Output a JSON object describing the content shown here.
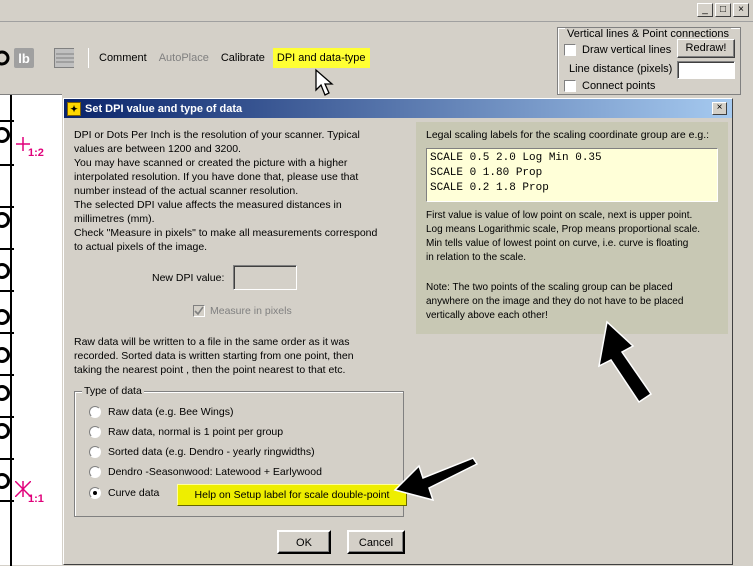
{
  "window": {
    "ctrls": [
      "_",
      "□",
      "×"
    ]
  },
  "toolbar": {
    "icons": [
      "circle-icon",
      "lb-icon",
      "grid-icon"
    ],
    "lb_text": "lb",
    "items": [
      {
        "label": "Comment",
        "state": "normal"
      },
      {
        "label": "AutoPlace",
        "state": "disabled"
      },
      {
        "label": "Calibrate",
        "state": "normal"
      },
      {
        "label": "DPI and data-type",
        "state": "highlight"
      }
    ]
  },
  "vertical_lines": {
    "title": "Vertical lines & Point connections",
    "draw_label": "Draw vertical lines",
    "redraw_label": "Redraw!",
    "distance_label": "Line distance (pixels)",
    "distance_value": "",
    "connect_label": "Connect points"
  },
  "canvas": {
    "label_top": "1:2",
    "label_bottom": "1:1"
  },
  "dialog": {
    "title": "Set DPI value and type of data",
    "close": "×",
    "intro": [
      "DPI or Dots Per Inch is the resolution of your scanner. Typical",
      "values are between 1200 and 3200.",
      "You may have scanned or created the picture with a higher",
      "interpolated resolution. If you have done that, please use that",
      "number instead of the actual scanner resolution.",
      "The selected DPI value affects the measured distances in",
      "millimetres (mm).",
      "Check \"Measure in pixels\" to make all measurements correspond",
      "to actual pixels of the image."
    ],
    "dpi_label": "New DPI value:",
    "dpi_value": "",
    "measure_label": "Measure in pixels",
    "raw_text": [
      "Raw data will be written to a file in the same order as it was",
      "recorded. Sorted data is written starting from one point, then",
      "taking the nearest point , then the point nearest to that etc."
    ],
    "type_group": "Type of data",
    "options": [
      {
        "label": "Raw data (e.g. Bee Wings)",
        "selected": false
      },
      {
        "label": "Raw data, normal is 1 point per group",
        "selected": false
      },
      {
        "label": "Sorted data (e.g. Dendro - yearly ringwidths)",
        "selected": false
      },
      {
        "label": "Dendro -Seasonwood: Latewood + Earlywood",
        "selected": false
      },
      {
        "label": "Curve data",
        "selected": true
      }
    ],
    "help_button": "Help on Setup label for scale double-point",
    "legal_title": "Legal scaling labels for the scaling coordinate group are e.g.:",
    "examples": [
      "SCALE 0.5 2.0 Log Min 0.35",
      "SCALE 0 1.80 Prop",
      "SCALE 0.2 1.8 Prop"
    ],
    "explain": [
      "First value is value of low point on scale, next is upper point.",
      "Log means Logarithmic scale, Prop means proportional scale.",
      "Min tells value of lowest point on curve, i.e. curve is floating",
      "in relation to the scale."
    ],
    "note": [
      "Note: The two points of the scaling group can be placed",
      "anywhere on the image and they do not have to be placed",
      "vertically above each other!"
    ],
    "ok": "OK",
    "cancel": "Cancel"
  },
  "colors": {
    "highlight": "#ffff33",
    "title_bar": "#0a246a",
    "help_bg": "#c8c8b4",
    "code_bg": "#ffffd8",
    "scale_marker": "#e0007a"
  }
}
